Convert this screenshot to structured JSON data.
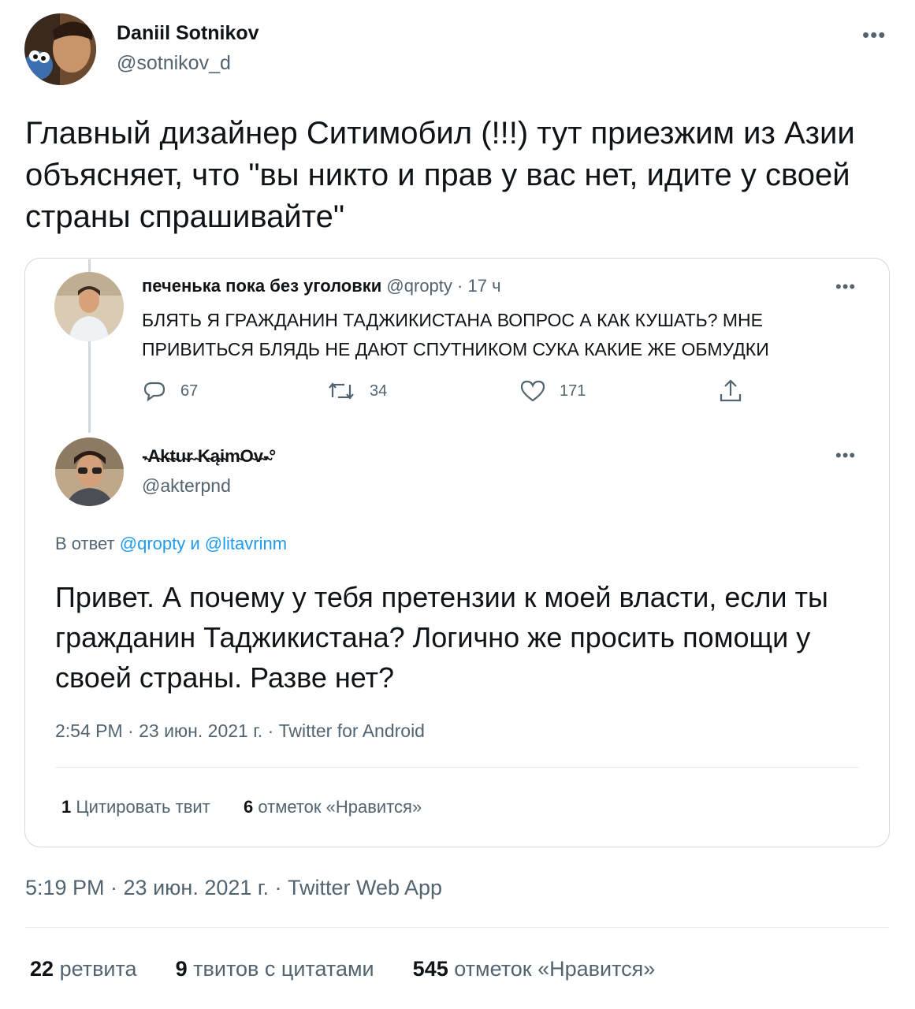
{
  "author": {
    "name": "Daniil Sotnikov",
    "handle": "@sotnikov_d"
  },
  "more_label": "•••",
  "tweet_text": "Главный дизайнер Ситимобил (!!!) тут приезжим из Азии объясняет, что \"вы никто и прав у вас нет, идите у своей страны спрашивайте\"",
  "quoted": {
    "parent": {
      "name": "печенька пока без уголовки",
      "handle": "@qropty",
      "sep": "·",
      "time": "17 ч",
      "text": "БЛЯТЬ Я ГРАЖДАНИН ТАДЖИКИСТАНА ВОПРОС А КАК КУШАТЬ? МНЕ ПРИВИТЬСЯ БЛЯДЬ НЕ ДАЮТ СПУТНИКОМ СУКА КАКИЕ ЖЕ ОБМУДКИ",
      "replies": "67",
      "retweets": "34",
      "likes": "171"
    },
    "reply": {
      "name": "-̴A̴k̴t̴u̴r̴ ̴K̴ą̴i̴m̴O̴v̴-̴°",
      "handle": "@akterpnd",
      "reply_prefix": "В ответ",
      "mention1": "@qropty",
      "conj": "и",
      "mention2": "@litavrinm",
      "text": "Привет. А почему у тебя претензии к моей власти, если ты гражданин Таджикистана? Логично же просить помощи у своей страны. Разве нет?",
      "meta": "2:54 PM · 23 июн. 2021 г. · Twitter for Android",
      "quote_count": "1",
      "quote_label": "Цитировать твит",
      "like_count": "6",
      "like_label": "отметок «Нравится»"
    }
  },
  "meta": "5:19 PM · 23 июн. 2021 г. · Twitter Web App",
  "stats": {
    "retweets": "22",
    "retweets_label": "ретвита",
    "quotes": "9",
    "quotes_label": "твитов с цитатами",
    "likes": "545",
    "likes_label": "отметок «Нравится»"
  },
  "colors": {
    "link": "#1d9bf0",
    "secondary_text": "#536471",
    "border": "#cfd9de"
  }
}
